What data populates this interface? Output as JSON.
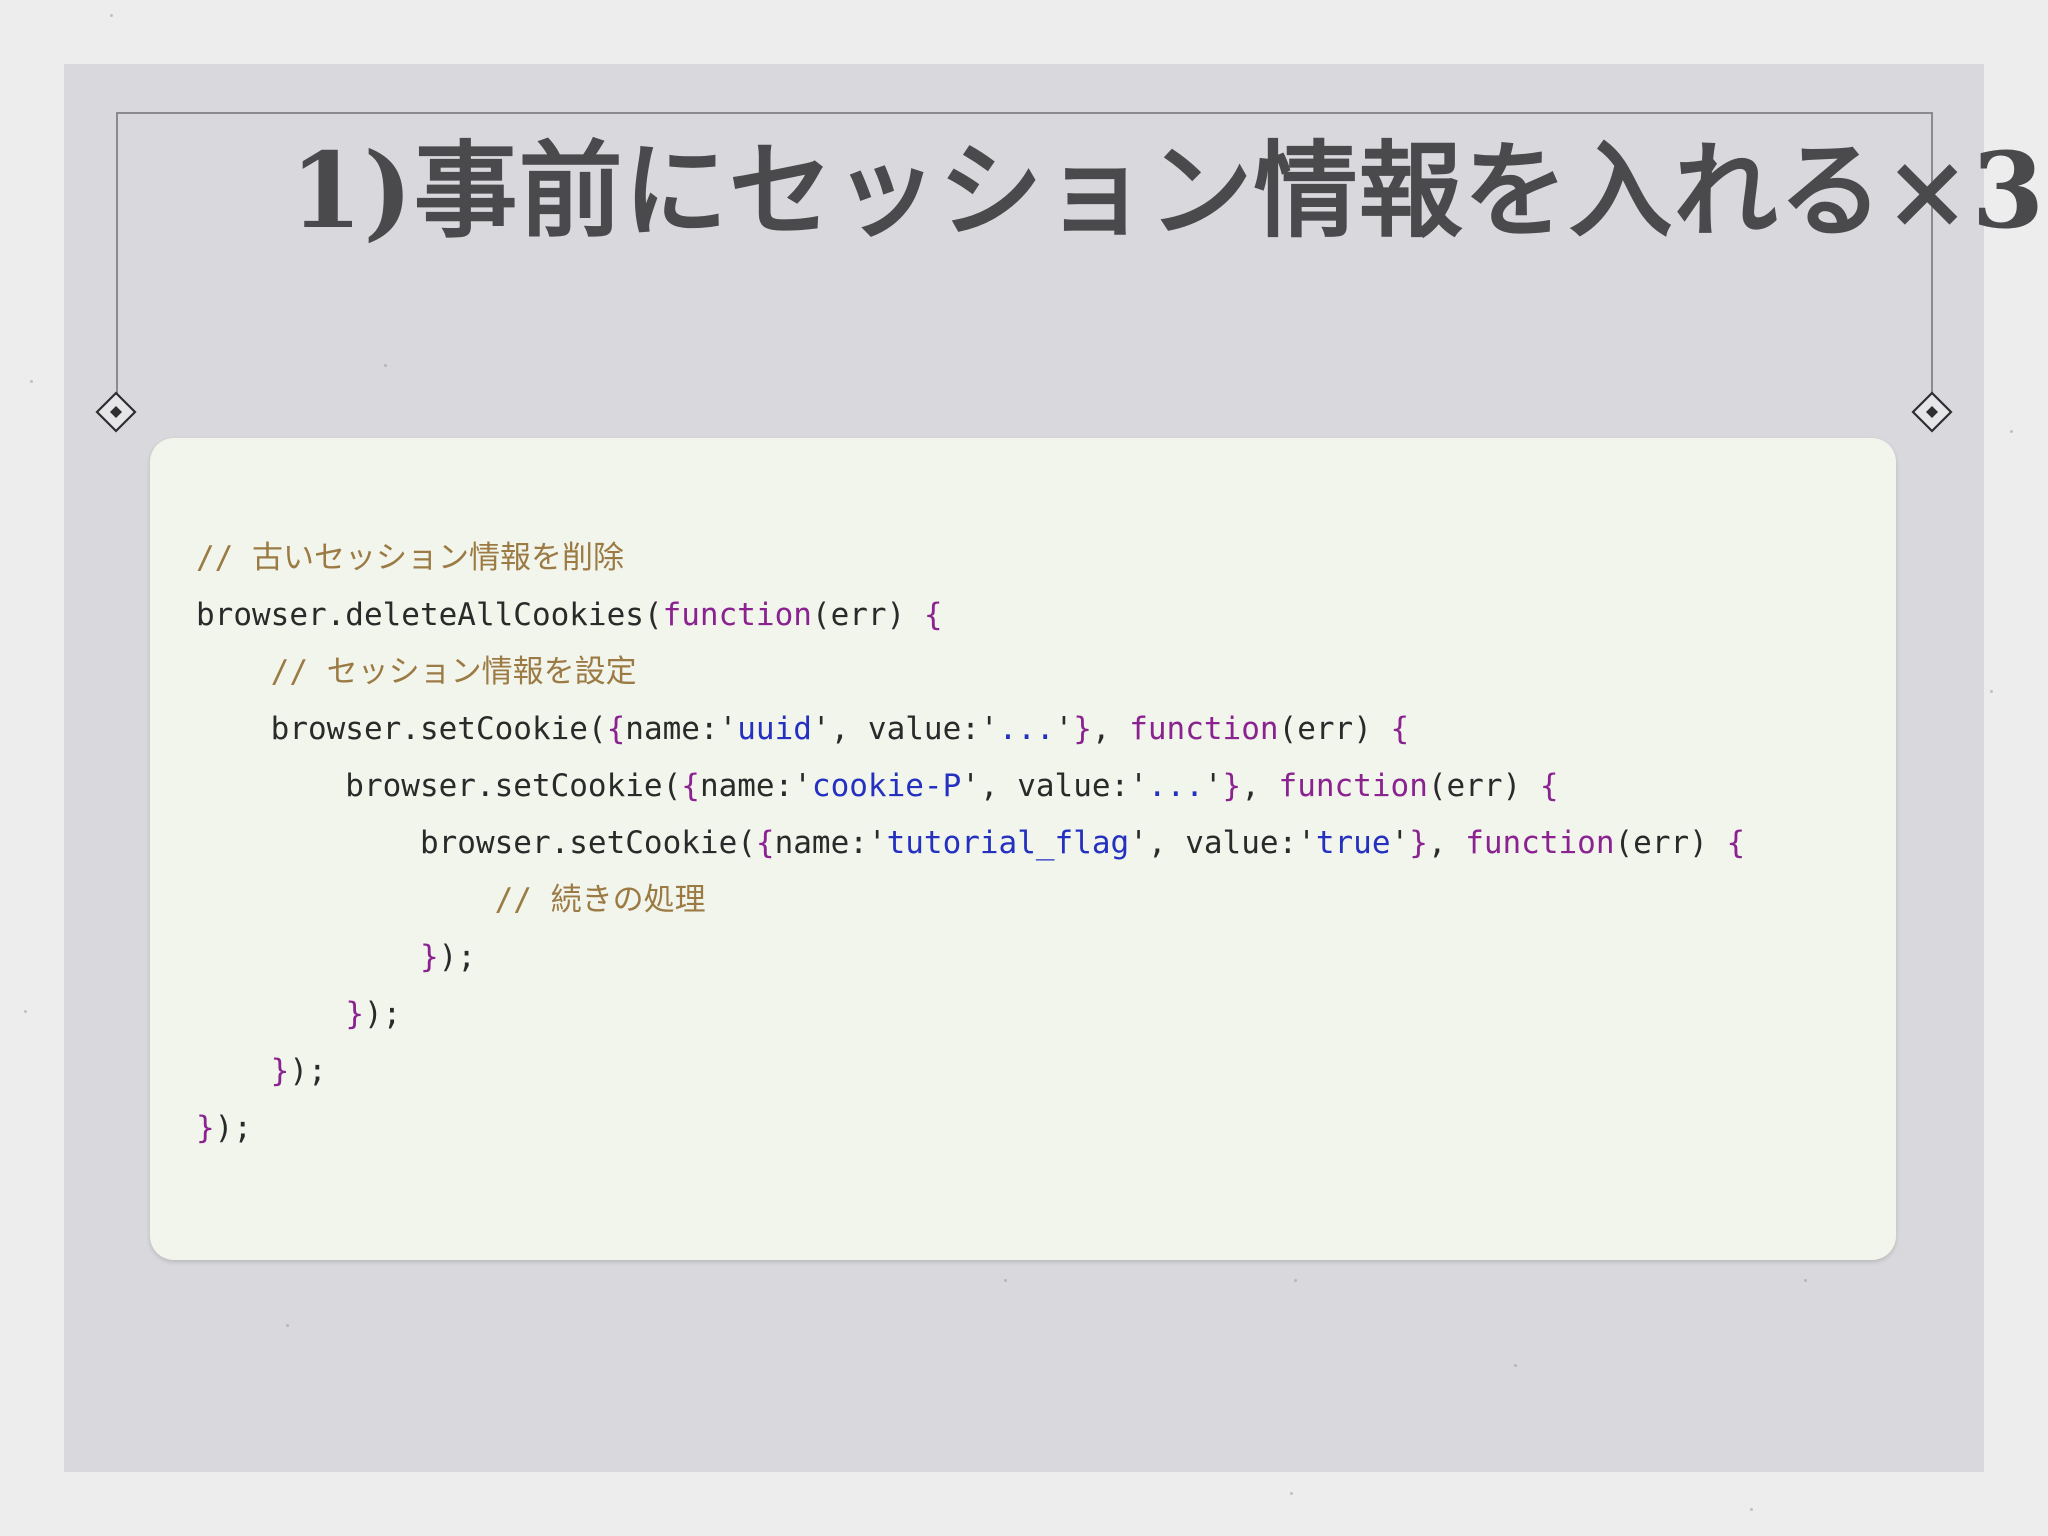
{
  "slide": {
    "title": "1)事前にセッション情報を入れる×3"
  },
  "code": {
    "lines": [
      [
        {
          "t": "cmt",
          "v": "// 古いセッション情報を削除"
        }
      ],
      [
        {
          "t": "plain",
          "v": "browser.deleteAllCookies("
        },
        {
          "t": "kw",
          "v": "function"
        },
        {
          "t": "plain",
          "v": "(err) "
        },
        {
          "t": "brace",
          "v": "{"
        }
      ],
      [
        {
          "t": "plain",
          "v": "    "
        },
        {
          "t": "cmt",
          "v": "// セッション情報を設定"
        }
      ],
      [
        {
          "t": "plain",
          "v": "    browser.setCookie("
        },
        {
          "t": "brace",
          "v": "{"
        },
        {
          "t": "plain",
          "v": "name:'"
        },
        {
          "t": "str",
          "v": "uuid"
        },
        {
          "t": "plain",
          "v": "', value:'"
        },
        {
          "t": "str",
          "v": "..."
        },
        {
          "t": "plain",
          "v": "'"
        },
        {
          "t": "brace",
          "v": "}"
        },
        {
          "t": "plain",
          "v": ", "
        },
        {
          "t": "kw",
          "v": "function"
        },
        {
          "t": "plain",
          "v": "(err) "
        },
        {
          "t": "brace",
          "v": "{"
        }
      ],
      [
        {
          "t": "plain",
          "v": "        browser.setCookie("
        },
        {
          "t": "brace",
          "v": "{"
        },
        {
          "t": "plain",
          "v": "name:'"
        },
        {
          "t": "str",
          "v": "cookie-P"
        },
        {
          "t": "plain",
          "v": "', value:'"
        },
        {
          "t": "str",
          "v": "..."
        },
        {
          "t": "plain",
          "v": "'"
        },
        {
          "t": "brace",
          "v": "}"
        },
        {
          "t": "plain",
          "v": ", "
        },
        {
          "t": "kw",
          "v": "function"
        },
        {
          "t": "plain",
          "v": "(err) "
        },
        {
          "t": "brace",
          "v": "{"
        }
      ],
      [
        {
          "t": "plain",
          "v": "            browser.setCookie("
        },
        {
          "t": "brace",
          "v": "{"
        },
        {
          "t": "plain",
          "v": "name:'"
        },
        {
          "t": "str",
          "v": "tutorial_flag"
        },
        {
          "t": "plain",
          "v": "', value:'"
        },
        {
          "t": "str",
          "v": "true"
        },
        {
          "t": "plain",
          "v": "'"
        },
        {
          "t": "brace",
          "v": "}"
        },
        {
          "t": "plain",
          "v": ", "
        },
        {
          "t": "kw",
          "v": "function"
        },
        {
          "t": "plain",
          "v": "(err) "
        },
        {
          "t": "brace",
          "v": "{"
        }
      ],
      [
        {
          "t": "plain",
          "v": "                "
        },
        {
          "t": "cmt",
          "v": "// 続きの処理"
        }
      ],
      [
        {
          "t": "plain",
          "v": "            "
        },
        {
          "t": "brace",
          "v": "}"
        },
        {
          "t": "plain",
          "v": ");"
        }
      ],
      [
        {
          "t": "plain",
          "v": "        "
        },
        {
          "t": "brace",
          "v": "}"
        },
        {
          "t": "plain",
          "v": ");"
        }
      ],
      [
        {
          "t": "plain",
          "v": "    "
        },
        {
          "t": "brace",
          "v": "}"
        },
        {
          "t": "plain",
          "v": ");"
        }
      ],
      [
        {
          "t": "brace",
          "v": "}"
        },
        {
          "t": "plain",
          "v": ");"
        }
      ]
    ],
    "colors": {
      "comment": "#9b7a44",
      "keyword": "#8a2390",
      "string": "#2430c0",
      "text": "#2a2a2a",
      "card": "#f2f5ec"
    }
  }
}
